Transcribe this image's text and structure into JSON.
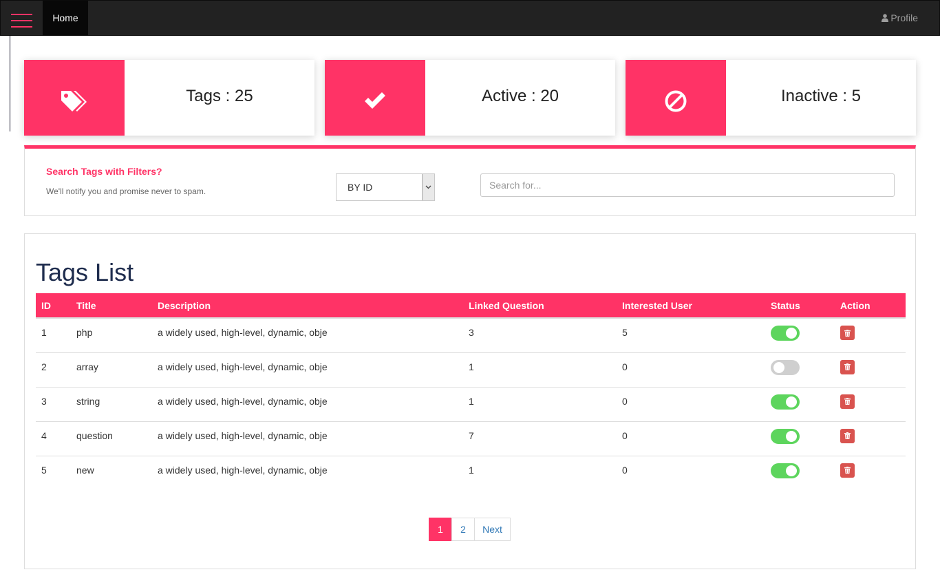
{
  "navbar": {
    "home_label": "Home",
    "profile_label": "Profile"
  },
  "stats": [
    {
      "label": "Tags : 25",
      "icon": "tags-icon"
    },
    {
      "label": "Active : 20",
      "icon": "check-icon"
    },
    {
      "label": "Inactive : 5",
      "icon": "ban-icon"
    }
  ],
  "filter": {
    "title": "Search Tags with Filters?",
    "subtitle": "We'll notify you and promise never to spam.",
    "select_value": "BY ID",
    "search_placeholder": "Search for..."
  },
  "list": {
    "title": "Tags List",
    "columns": [
      "ID",
      "Title",
      "Description",
      "Linked Question",
      "Interested User",
      "Status",
      "Action"
    ],
    "rows": [
      {
        "id": "1",
        "title": "php",
        "description": "a widely used, high-level, dynamic, obje",
        "linked": "3",
        "interested": "5",
        "status": "on"
      },
      {
        "id": "2",
        "title": "array",
        "description": "a widely used, high-level, dynamic, obje",
        "linked": "1",
        "interested": "0",
        "status": "off"
      },
      {
        "id": "3",
        "title": "string",
        "description": "a widely used, high-level, dynamic, obje",
        "linked": "1",
        "interested": "0",
        "status": "on"
      },
      {
        "id": "4",
        "title": "question",
        "description": "a widely used, high-level, dynamic, obje",
        "linked": "7",
        "interested": "0",
        "status": "on"
      },
      {
        "id": "5",
        "title": "new",
        "description": "a widely used, high-level, dynamic, obje",
        "linked": "1",
        "interested": "0",
        "status": "on"
      }
    ]
  },
  "pagination": {
    "pages": [
      "1",
      "2"
    ],
    "active": "1",
    "next_label": "Next"
  },
  "colors": {
    "accent": "#ff3366",
    "navbar": "#222222",
    "toggle_on": "#5dd55d",
    "delete": "#d9534f"
  }
}
